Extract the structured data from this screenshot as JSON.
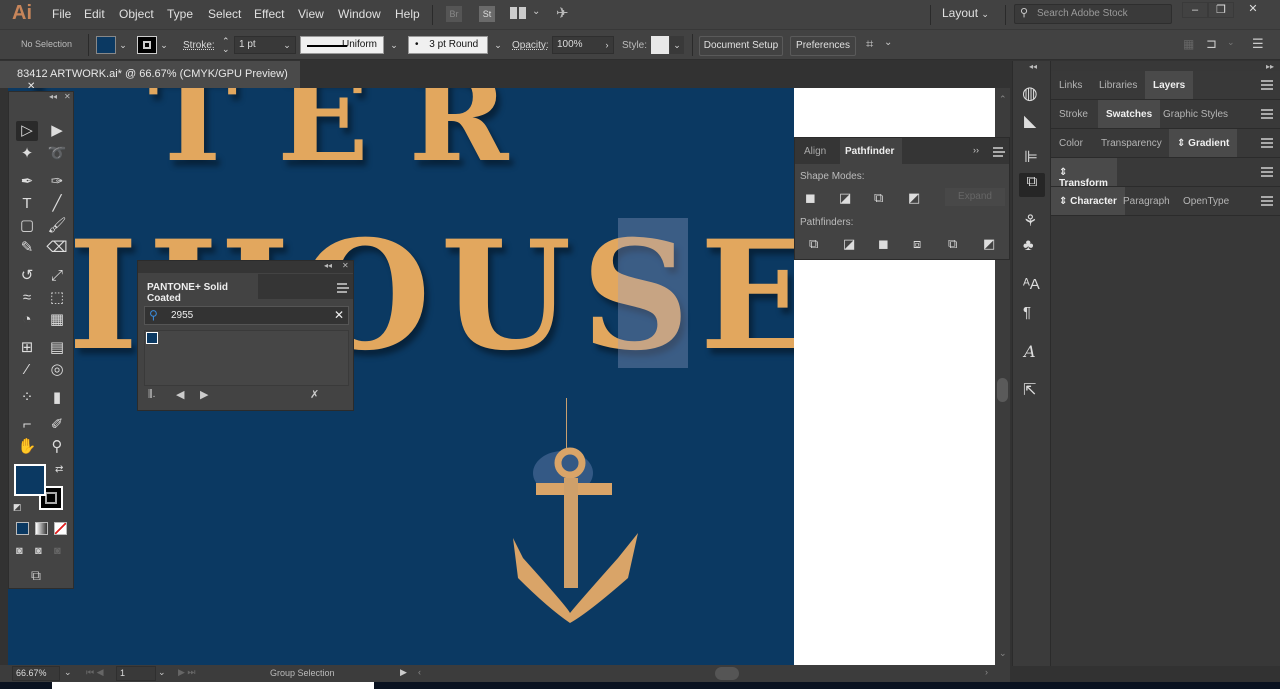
{
  "app": {
    "logo": "Ai",
    "menu": [
      "File",
      "Edit",
      "Object",
      "Type",
      "Select",
      "Effect",
      "View",
      "Window",
      "Help"
    ],
    "bridge_label": "Br",
    "stock_label": "St",
    "workspace": "Layout",
    "search_placeholder": "Search Adobe Stock",
    "window_buttons": [
      "–",
      "❐",
      "✕"
    ]
  },
  "control_bar": {
    "selection": "No Selection",
    "fill_color": "#0b3962",
    "stroke_label": "Stroke:",
    "stroke_weight": "1 pt",
    "stroke_profile": "Uniform",
    "brush": "3 pt Round",
    "opacity_label": "Opacity:",
    "opacity": "100%",
    "style_label": "Style:",
    "document_setup": "Document Setup",
    "preferences": "Preferences"
  },
  "document": {
    "tab_title": "83412 ARTWORK.ai* @ 66.67% (CMYK/GPU Preview)",
    "close": "✕"
  },
  "artwork": {
    "line1": "STER",
    "line2": "HOUSE",
    "background": "#0b3962",
    "letter_color": "#e2a75e"
  },
  "toolbox": {
    "fill_color": "#0b3962",
    "stroke_color": "#000000"
  },
  "pantone_panel": {
    "title": "PANTONE+ Solid Coated",
    "search_value": "2955",
    "swatch_color": "#0b3962"
  },
  "pathfinder_panel": {
    "tabs": [
      "Align",
      "Pathfinder"
    ],
    "active_tab": "Pathfinder",
    "shape_modes_label": "Shape Modes:",
    "expand_label": "Expand",
    "pathfinders_label": "Pathfinders:"
  },
  "right_panels": {
    "row1": [
      "Links",
      "Libraries",
      "Layers"
    ],
    "row2": [
      "Stroke",
      "Swatches",
      "Graphic Styles"
    ],
    "row3": [
      "Color",
      "Transparency",
      "Gradient"
    ],
    "row4": [
      "Transform"
    ],
    "row5": [
      "Character",
      "Paragraph",
      "OpenType"
    ]
  },
  "status_bar": {
    "zoom": "66.67%",
    "artboard": "1",
    "tool": "Group Selection"
  }
}
